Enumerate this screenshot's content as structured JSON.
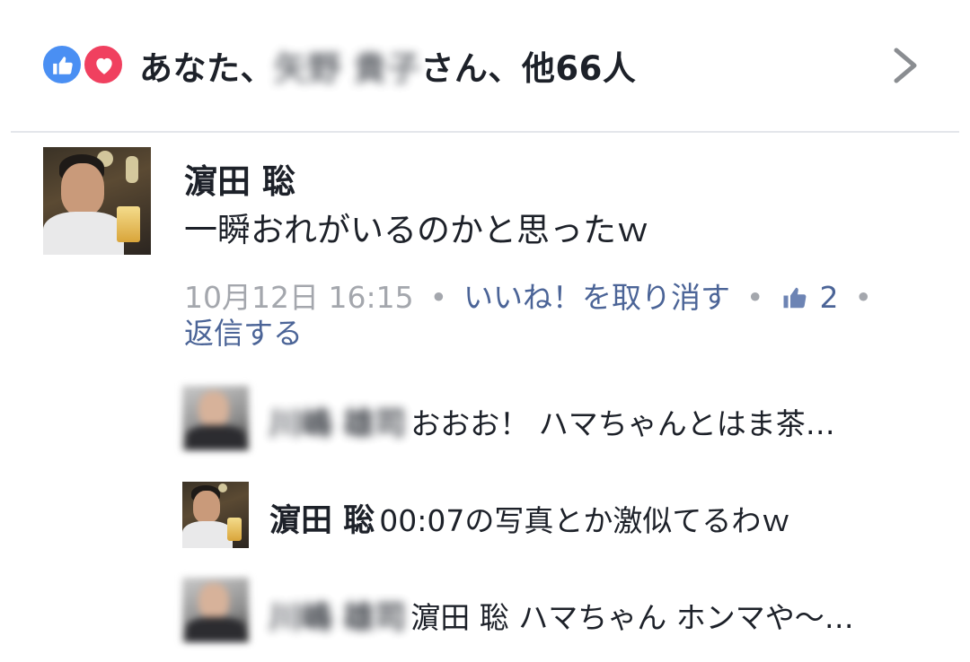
{
  "reactions": {
    "summary_prefix": "あなた、",
    "blurred_name": "矢野 貴子",
    "summary_suffix": "さん、他66人",
    "icons": [
      "like-icon",
      "love-icon"
    ],
    "colors": {
      "like": "#4a8ff3",
      "love": "#f0405f"
    }
  },
  "comment": {
    "author": "濵田 聡",
    "text": "一瞬おれがいるのかと思ったｗ",
    "timestamp": "10月12日 16:15",
    "unlike_label": "いいね！を取り消す",
    "like_count": "2",
    "reply_label": "返信する"
  },
  "replies": [
    {
      "author": "川嶋 雄司",
      "author_blurred": true,
      "text": "おおお！ ハマちゃんとはま茶…"
    },
    {
      "author": "濵田 聡",
      "author_blurred": false,
      "text": "00:07の写真とか激似てるわｗ"
    },
    {
      "author": "川嶋 雄司",
      "author_blurred": true,
      "text": "濵田 聡 ハマちゃん ホンマや〜…"
    }
  ],
  "colors": {
    "link": "#4b6497",
    "muted": "#a4a7ad",
    "text": "#1d2129"
  }
}
